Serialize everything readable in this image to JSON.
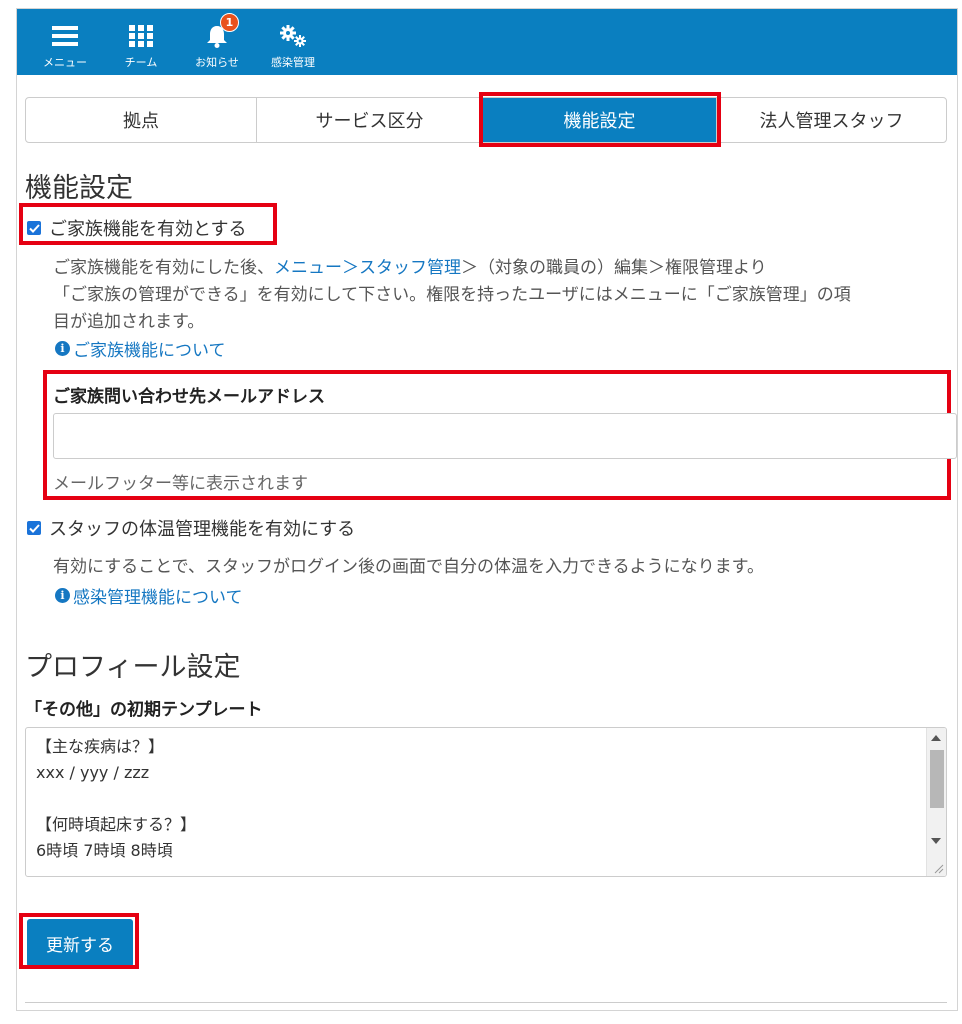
{
  "header": {
    "nav": [
      {
        "label": "メニュー",
        "icon": "hamburger-icon"
      },
      {
        "label": "チーム",
        "icon": "grid-icon"
      },
      {
        "label": "お知らせ",
        "icon": "bell-icon",
        "badge": "1"
      },
      {
        "label": "感染管理",
        "icon": "gears-icon"
      }
    ]
  },
  "tabs": [
    {
      "label": "拠点",
      "active": false
    },
    {
      "label": "サービス区分",
      "active": false
    },
    {
      "label": "機能設定",
      "active": true
    },
    {
      "label": "法人管理スタッフ",
      "active": false
    }
  ],
  "feature_section": {
    "title": "機能設定",
    "family": {
      "checkbox_label": "ご家族機能を有効とする",
      "checked": true,
      "desc_line1_pre": "ご家族機能を有効にした後、",
      "desc_line1_link": "メニュー＞スタッフ管理",
      "desc_line1_post": "＞（対象の職員の）編集＞権限管理より",
      "desc_line2": "「ご家族の管理ができる」を有効にして下さい。権限を持ったユーザにはメニューに「ご家族管理」の項",
      "desc_line3": "目が追加されます。",
      "info_link": "ご家族機能について"
    },
    "email": {
      "label": "ご家族問い合わせ先メールアドレス",
      "value": "",
      "help": "メールフッター等に表示されます"
    },
    "temperature": {
      "checkbox_label": "スタッフの体温管理機能を有効にする",
      "checked": true,
      "desc": "有効にすることで、スタッフがログイン後の画面で自分の体温を入力できるようになります。",
      "info_link": "感染管理機能について"
    }
  },
  "profile_section": {
    "title": "プロフィール設定",
    "template_label": "「その他」の初期テンプレート",
    "template_text": "【主な疾病は？】\nxxx / yyy / zzz\n\n【何時頃起床する？】\n6時頃 7時頃 8時頃"
  },
  "submit_label": "更新する",
  "colors": {
    "primary": "#0a7fc0",
    "highlight": "#e50012",
    "link": "#1577c2"
  }
}
